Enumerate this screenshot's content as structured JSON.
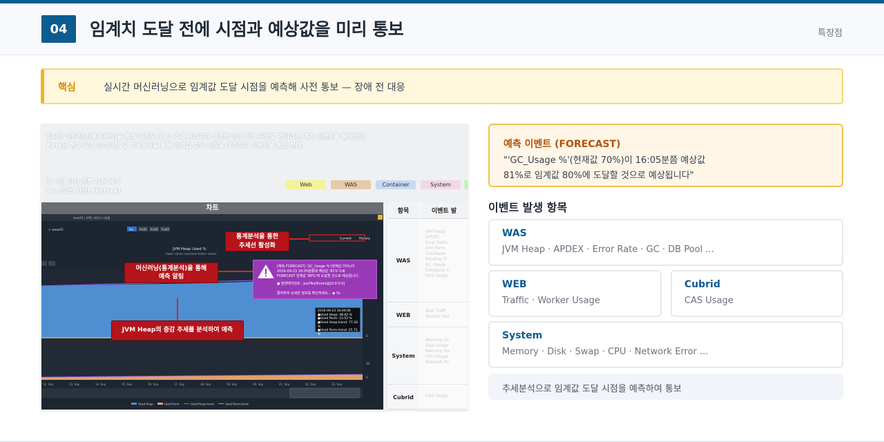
{
  "header": {
    "number": "04",
    "title": "임계치 도달 전에 시점과 예상값을 미리 통보",
    "tag": "특장점"
  },
  "key": {
    "label": "핵심",
    "text": "실시간 머신러닝으로 임계값 도달 시점을 예측해 사전 통보 — 장애 전 대응"
  },
  "screenshot": {
    "desc_line1": "실시간 머신러닝(통계분석)을 통해 일정도 및 그 추세 관리자가 설정한 임계 값에 도달할 것이라는 예측 이벤트를 통보한다.",
    "desc_line2": "APM은 현재 실시 모니터링 및 추세분석을 통해 임계값 도달 시점을 예측하여 이벤트를 통보 한다.",
    "side_line1": "실 시간 이상 징후 사전 예측",
    "side_line2": "s > (모든 차트) History)",
    "pills": [
      {
        "label": "Web",
        "color": "#f3f39b"
      },
      {
        "label": "WAS",
        "color": "#e8c9a8"
      },
      {
        "label": "Container",
        "color": "#c7d9f5"
      },
      {
        "label": "System",
        "color": "#f1d9e4"
      }
    ],
    "chart_title": "차트",
    "crumb": "www01 | JVM | 메모리 사용률",
    "server": "> www01",
    "tabs": [
      "lns",
      "lnsd1",
      "lnsd2",
      "lnsd3"
    ],
    "chart_name": "JVM Heap Used %",
    "chart_sub": "lower values represent better values",
    "toggle_current": "Current",
    "toggle_history": "History",
    "callout_trend": "통계분석을 통한\n추세선 활성화",
    "callout_ml": "머신러닝(통계분석)을 통해\n예측 알림",
    "callout_heap": "JVM Heap의 증감 추세를 분석하여 예측",
    "popup_lines": [
      "[예측-FORECAST] 'GC_Usage %'(현재값:70%)이",
      "2016-09-23 16:05분쯤에 예상값 '81%'으로",
      "FORECAST 임계값 '80%'에 도달할 것으로 예상됩니다.",
      "● 발생에이전트 : JustTestEvent@[0.0.0.0]",
      "클릭하여 상세한 정보를 확인하세요...  ◉ 5s"
    ],
    "readout_lines": [
      "2016-09-23 16:00:00",
      "●Used Heap: 46.62 %",
      "●Used Perm: 13.52 %",
      "●Used Heap-trend: 77.28 %",
      "●Used Perm-trend: 25.73 %"
    ],
    "x_ticks": [
      "12. Sep",
      "13. Sep",
      "14. Sep",
      "15. Sep",
      "16. Sep",
      "17. Sep",
      "18. Sep",
      "19. Sep",
      "20. Sep",
      "21. Sep",
      "22. Sep",
      "23. Sep"
    ],
    "y_ticks": [
      "50",
      "0",
      "50",
      "0"
    ],
    "legend": [
      "Used Heap",
      "Used Perm",
      "Used Heap-trend",
      "Used Perm-trend"
    ],
    "table_headers": [
      "항목",
      "이벤트 발"
    ],
    "table_rows": [
      {
        "label": "WAS",
        "items": [
          "JVM Heap",
          "APDEX",
          "Error Ratio",
          "JVM Perm",
          "Database",
          "Pending Tr",
          "GC Usage",
          "Database C",
          "Port Usage"
        ]
      },
      {
        "label": "WEB",
        "items": [
          "Web Traffi",
          "Worker Usa"
        ]
      },
      {
        "label": "System",
        "items": [
          "Memory Us",
          "Disk Usage",
          "Memory Sw",
          "CPU Usage",
          "Network Pa"
        ]
      },
      {
        "label": "Cubrid",
        "items": [
          "CAS Usage"
        ]
      }
    ]
  },
  "forecast": {
    "title": "예측 이벤트 (FORECAST)",
    "line1": "\"'GC_Usage %'(현재값 70%)이 16:05분쯤 예상값",
    "line2": "81%로 임계값 80%에 도달할 것으로 예상됩니다\""
  },
  "events": {
    "title": "이벤트 발생 항목",
    "cards": [
      {
        "name": "WAS",
        "items": "JVM Heap · APDEX · Error Rate · GC · DB Pool ..."
      },
      {
        "name": "WEB",
        "items": "Traffic · Worker Usage"
      },
      {
        "name": "Cubrid",
        "items": "CAS Usage"
      },
      {
        "name": "System",
        "items": "Memory · Disk · Swap · CPU · Network Error ..."
      }
    ],
    "note": "추세분석으로 임계값 도달 시점을 예측하여 통보"
  }
}
